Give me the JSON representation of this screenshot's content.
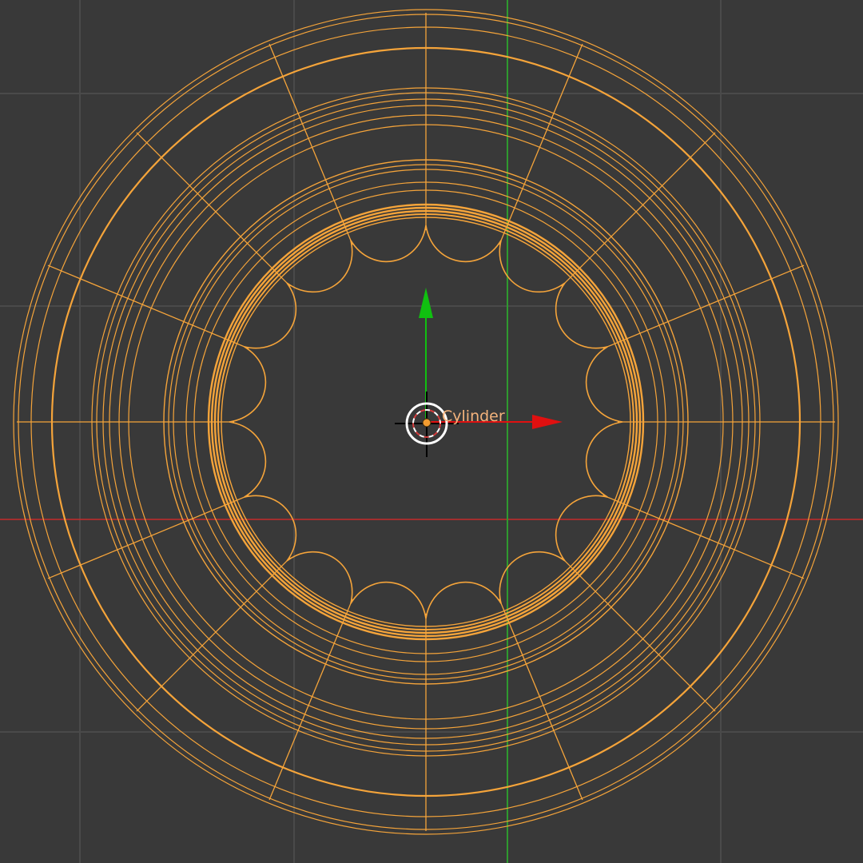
{
  "viewport": {
    "object_name": "Cylinder",
    "background_color": "#393939",
    "grid_color": "#4a4a4a",
    "x_axis_color": "#c62a2a",
    "y_axis_color": "#2f9a2f",
    "wire_color": "#f5a43a"
  },
  "gizmo": {
    "x_arrow_color": "#e01010",
    "y_arrow_color": "#10c010",
    "cursor_icon": "3d-cursor-icon"
  }
}
